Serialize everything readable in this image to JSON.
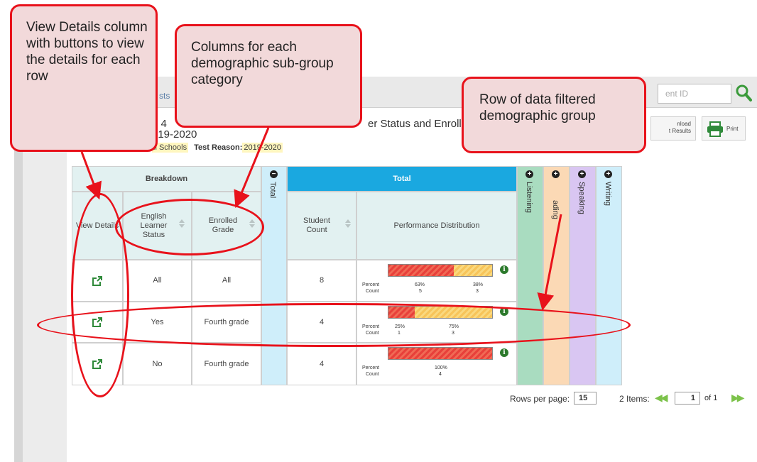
{
  "callouts": {
    "view_details": "View Details column with buttons to view the details for each row",
    "subgroup": "Columns for each demographic sub-group category",
    "row_filtered": "Row of data filtered demographic group"
  },
  "header": {
    "crumb": "sts",
    "title": "n",
    "search_placeholder": "ent ID"
  },
  "report": {
    "title_fragment": "e 4",
    "year_fragment": "019-2020",
    "subtitle_fragment": "er Status and Enrolled",
    "school_fragment": "ll Schools",
    "test_reason_label": "Test Reason:",
    "test_reason_value": "2019-2020"
  },
  "toolbar": {
    "download_line1": "nload",
    "download_line2": "t Results",
    "print_label": "Print"
  },
  "table": {
    "breakdown_header": "Breakdown",
    "total_header": "Total",
    "total_vertical": "Total",
    "columns": {
      "view_details": "View Details",
      "english_learner": "English Learner Status",
      "enrolled_grade": "Enrolled Grade",
      "student_count": "Student Count",
      "performance": "Performance Distribution"
    },
    "collapsed_columns": [
      "Listening",
      "Reading",
      "Speaking",
      "Writing"
    ],
    "visible_collapsed_labels": [
      "Listening",
      "ading",
      "Speaking",
      "Writing"
    ],
    "rows": [
      {
        "el_status": "All",
        "grade": "All",
        "count": "8",
        "pct_red": "63%",
        "pct_yellow": "38%",
        "cnt_red": "5",
        "cnt_yellow": "3",
        "red_fraction": 0.63
      },
      {
        "el_status": "Yes",
        "grade": "Fourth grade",
        "count": "4",
        "pct_red": "25%",
        "pct_yellow": "75%",
        "cnt_red": "1",
        "cnt_yellow": "3",
        "red_fraction": 0.25
      },
      {
        "el_status": "No",
        "grade": "Fourth grade",
        "count": "4",
        "pct_red": "100%",
        "pct_yellow": "",
        "cnt_red": "4",
        "cnt_yellow": "",
        "red_fraction": 1.0
      }
    ],
    "percent_label": "Percent",
    "count_label": "Count"
  },
  "pager": {
    "rows_per_page_label": "Rows per page:",
    "rows_per_page": "15",
    "items_label": "2 Items:",
    "page": "1",
    "of_label": "of 1"
  },
  "colors": {
    "callout_border": "#e8121b",
    "callout_fill": "#f2d9da",
    "total_header": "#1aa8e0",
    "listening": "#a9dcc0",
    "reading": "#fbd9b5",
    "speaking": "#d9c6f2",
    "writing": "#cfeefa"
  }
}
